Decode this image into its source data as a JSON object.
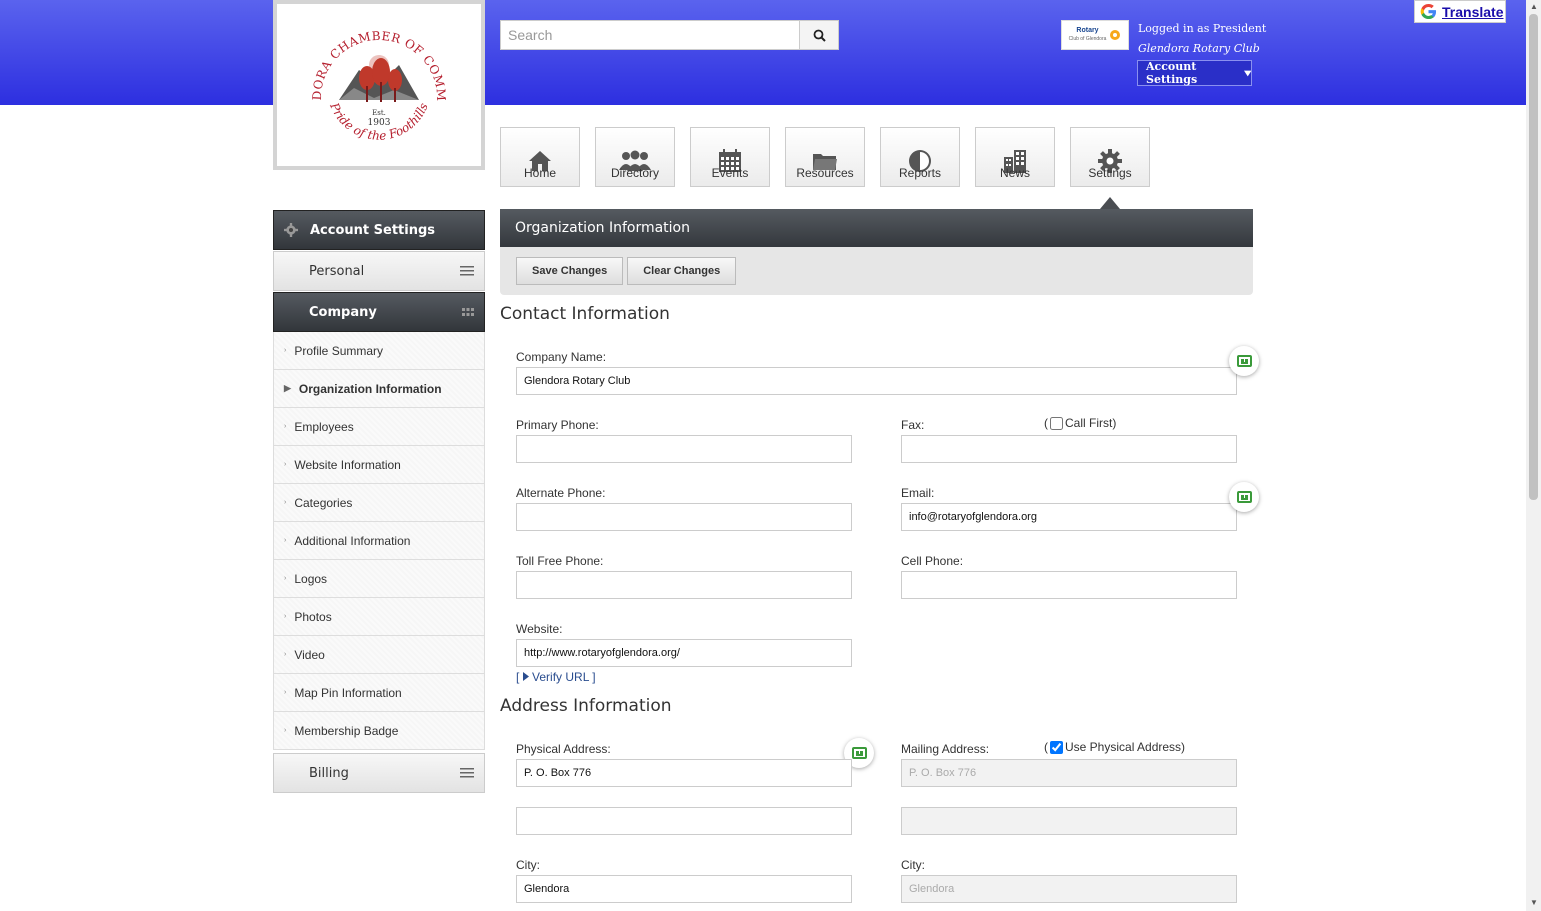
{
  "header": {
    "logo": {
      "org_name": "GLENDORA CHAMBER OF COMMERCE",
      "est": "Est.",
      "year": "1903",
      "tagline": "Pride of the Foothills"
    },
    "search_placeholder": "Search",
    "rotary_logo_text": "Rotary",
    "rotary_logo_sub": "Club of Glendora",
    "logged_in_as": "Logged in as President",
    "org": "Glendora Rotary Club",
    "account_button": "Account Settings",
    "translate_label": "Translate"
  },
  "nav": [
    {
      "label": "Home",
      "icon": "home-icon"
    },
    {
      "label": "Directory",
      "icon": "people-icon"
    },
    {
      "label": "Events",
      "icon": "calendar-icon"
    },
    {
      "label": "Resources",
      "icon": "folder-icon"
    },
    {
      "label": "Reports",
      "icon": "pie-chart-icon"
    },
    {
      "label": "News",
      "icon": "buildings-icon"
    },
    {
      "label": "Settings",
      "icon": "gear-icon"
    }
  ],
  "sidebar": {
    "title": "Account Settings",
    "sections": {
      "personal": "Personal",
      "company": "Company",
      "billing": "Billing"
    },
    "items": [
      "Profile Summary",
      "Organization Information",
      "Employees",
      "Website Information",
      "Categories",
      "Additional Information",
      "Logos",
      "Photos",
      "Video",
      "Map Pin Information",
      "Membership Badge"
    ],
    "active_item": "Organization Information"
  },
  "panel": {
    "title": "Organization Information",
    "save_label": "Save Changes",
    "clear_label": "Clear Changes"
  },
  "contact": {
    "title": "Contact Information",
    "company_name_label": "Company Name:",
    "company_name": "Glendora Rotary Club",
    "primary_phone_label": "Primary Phone:",
    "primary_phone": "",
    "fax_label": "Fax:",
    "fax": "",
    "call_first_open": "(",
    "call_first_label": "Call First)",
    "call_first_checked": false,
    "alt_phone_label": "Alternate Phone:",
    "alt_phone": "",
    "email_label": "Email:",
    "email": "info@rotaryofglendora.org",
    "toll_free_label": "Toll Free Phone:",
    "toll_free": "",
    "cell_label": "Cell Phone:",
    "cell": "",
    "website_label": "Website:",
    "website": "http://www.rotaryofglendora.org/",
    "verify_open": "[",
    "verify_label": "Verify URL",
    "verify_close": "]"
  },
  "address": {
    "title": "Address Information",
    "physical_label": "Physical Address:",
    "physical_line1": "P. O. Box 776",
    "physical_line2": "",
    "mailing_label": "Mailing Address:",
    "use_physical_open": "(",
    "use_physical_label": "Use Physical Address)",
    "use_physical_checked": true,
    "mailing_line1": "P. O. Box 776",
    "mailing_line2": "",
    "city_label": "City:",
    "city": "Glendora",
    "mailing_city_label": "City:",
    "mailing_city": "Glendora"
  },
  "colors": {
    "header_top": "#5a63ee",
    "header_bottom": "#2d2fe0",
    "dark_bar": "#3a3e43",
    "vcard_green": "#3a9a3a"
  }
}
